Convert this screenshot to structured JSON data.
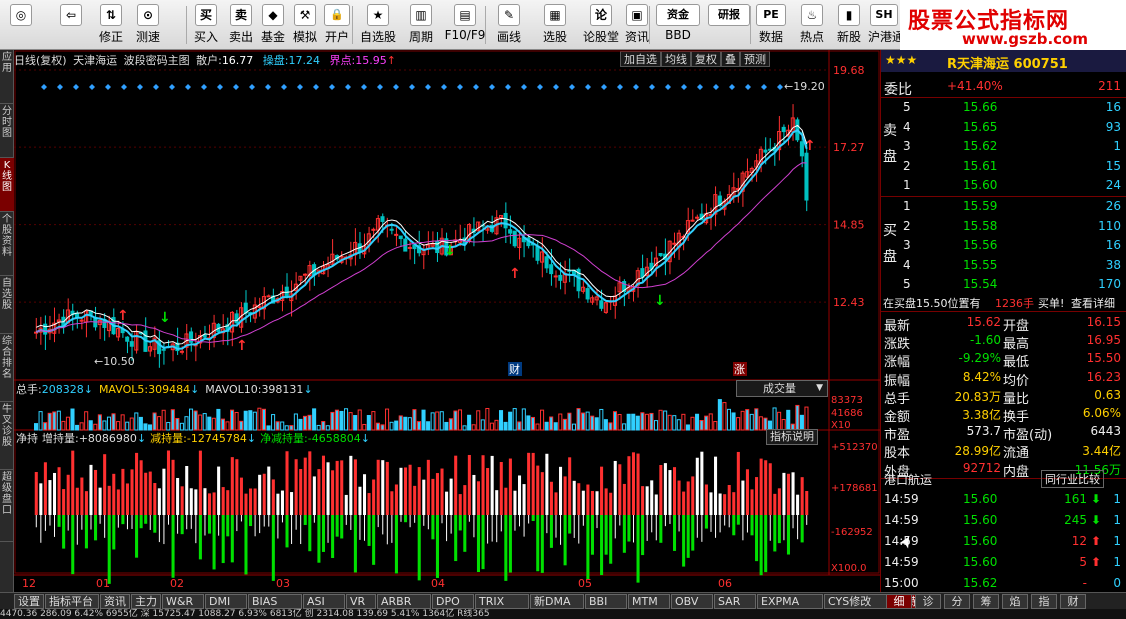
{
  "toolbar": [
    {
      "label": "",
      "icon": "app-logo-icon",
      "glyph": "◎"
    },
    {
      "label": "",
      "icon": "back-arrow-icon",
      "glyph": "⇦"
    },
    {
      "label": "修正",
      "icon": "refresh-icon",
      "glyph": "⇅"
    },
    {
      "label": "测速",
      "icon": "speed-test-icon",
      "glyph": "⊙"
    },
    {
      "label": "买入",
      "icon": "buy-icon",
      "glyph": "买"
    },
    {
      "label": "卖出",
      "icon": "sell-icon",
      "glyph": "卖"
    },
    {
      "label": "基金",
      "icon": "fund-icon",
      "glyph": "◆"
    },
    {
      "label": "模拟",
      "icon": "simulate-icon",
      "glyph": "⚒"
    },
    {
      "label": "开户",
      "icon": "open-account-icon",
      "glyph": "🔒"
    },
    {
      "label": "自选股",
      "icon": "watchlist-icon",
      "glyph": "★"
    },
    {
      "label": "周期",
      "icon": "period-icon",
      "glyph": "▥"
    },
    {
      "label": "F10/F9",
      "icon": "f10-icon",
      "glyph": "▤"
    },
    {
      "label": "画线",
      "icon": "draw-line-icon",
      "glyph": "✎"
    },
    {
      "label": "选股",
      "icon": "stock-picker-icon",
      "glyph": "▦"
    },
    {
      "label": "论股堂",
      "icon": "forum-icon",
      "glyph": "论"
    },
    {
      "label": "资讯",
      "icon": "news-icon",
      "glyph": "▣"
    },
    {
      "label": "BBD",
      "icon": "bbd-icon",
      "glyph": "资金"
    },
    {
      "label": "",
      "icon": "research-icon",
      "glyph": "研报"
    },
    {
      "label": "数据",
      "icon": "data-icon",
      "glyph": "PE"
    },
    {
      "label": "热点",
      "icon": "hot-icon",
      "glyph": "♨"
    },
    {
      "label": "新股",
      "icon": "new-stock-icon",
      "glyph": "▮"
    },
    {
      "label": "沪港通",
      "icon": "hk-connect-icon",
      "glyph": "SH"
    }
  ],
  "brand": {
    "line1": "股票公式指标网",
    "line2": "www.gszb.com"
  },
  "left_tabs": [
    "应用",
    "分时图",
    "K线图",
    "个股资料",
    "自选股",
    "综合排名",
    "牛叉诊股",
    "超级盘口"
  ],
  "info": {
    "period": "日线(复权)",
    "name": "天津海运",
    "indicator": "波段密码主图",
    "scatter_label": "散户:",
    "scatter_value": "16.77",
    "operator_label": "操盘:",
    "operator_value": "17.24",
    "point_label": "界点:",
    "point_value": "15.95"
  },
  "chart_buttons": [
    "加自选",
    "均线",
    "复权",
    "叠",
    "预测"
  ],
  "chart_data": {
    "type": "candlestick",
    "y_ticks": [
      "19.68",
      "17.27",
      "14.85",
      "12.43"
    ],
    "y_range": [
      10.0,
      19.68
    ],
    "high_annotation": "19.20",
    "low_annotation": "10.50",
    "x_labels": [
      "12",
      "01",
      "02",
      "03",
      "04",
      "05",
      "06"
    ],
    "markers": [
      "财",
      "涨"
    ]
  },
  "volume": {
    "total_label": "总手:",
    "total_value": "208328",
    "mavol5_label": "MAVOL5:",
    "mavol5_value": "309484",
    "mavol10_label": "MAVOL10:",
    "mavol10_value": "398131",
    "dropdown": "成交量",
    "y_ticks": [
      "83373",
      "41686",
      "X10"
    ]
  },
  "hold": {
    "title": "净持",
    "inc_label": "增持量:",
    "inc_value": "+8086980",
    "dec_label": "减持量:",
    "dec_value": "-12745784",
    "net_label": "净减持量:",
    "net_value": "-4658804",
    "help": "指标说明",
    "y_ticks": [
      "+512370",
      "+178681",
      "-162952",
      "X100.0"
    ]
  },
  "quote": {
    "title": "R天津海运 600751",
    "weibi_label": "委比",
    "weibi_value": "+41.40%",
    "weidiff": "211",
    "sell_label": "卖盘",
    "buy_label": "买盘",
    "asks": [
      {
        "lvl": "5",
        "price": "15.66",
        "vol": "16"
      },
      {
        "lvl": "4",
        "price": "15.65",
        "vol": "93"
      },
      {
        "lvl": "3",
        "price": "15.62",
        "vol": "1"
      },
      {
        "lvl": "2",
        "price": "15.61",
        "vol": "15"
      },
      {
        "lvl": "1",
        "price": "15.60",
        "vol": "24"
      }
    ],
    "bids": [
      {
        "lvl": "1",
        "price": "15.59",
        "vol": "26"
      },
      {
        "lvl": "2",
        "price": "15.58",
        "vol": "110"
      },
      {
        "lvl": "3",
        "price": "15.56",
        "vol": "16"
      },
      {
        "lvl": "4",
        "price": "15.55",
        "vol": "38"
      },
      {
        "lvl": "5",
        "price": "15.54",
        "vol": "170"
      }
    ],
    "msg_a": "在买盘15.50位置有",
    "msg_b": "1236手",
    "msg_c": "买单!",
    "msg_link": "查看详细",
    "stats": [
      {
        "l1": "最新",
        "v1": "15.62",
        "c1": "red",
        "l2": "开盘",
        "v2": "16.15",
        "c2": "red"
      },
      {
        "l1": "涨跌",
        "v1": "-1.60",
        "c1": "grn",
        "l2": "最高",
        "v2": "16.95",
        "c2": "red"
      },
      {
        "l1": "涨幅",
        "v1": "-9.29%",
        "c1": "grn",
        "l2": "最低",
        "v2": "15.50",
        "c2": "red"
      },
      {
        "l1": "振幅",
        "v1": "8.42%",
        "c1": "yel",
        "l2": "均价",
        "v2": "16.23",
        "c2": "red"
      },
      {
        "l1": "总手",
        "v1": "20.83万",
        "c1": "yel",
        "l2": "量比",
        "v2": "0.63",
        "c2": "yel"
      },
      {
        "l1": "金额",
        "v1": "3.38亿",
        "c1": "yel",
        "l2": "换手",
        "v2": "6.06%",
        "c2": "yel"
      },
      {
        "l1": "市盈",
        "v1": "573.7",
        "c1": "wht",
        "l2": "市盈(动)",
        "v2": "6443",
        "c2": "wht"
      },
      {
        "l1": "股本",
        "v1": "28.99亿",
        "c1": "yel",
        "l2": "流通",
        "v2": "3.44亿",
        "c2": "yel"
      },
      {
        "l1": "外盘",
        "v1": "92712",
        "c1": "red",
        "l2": "内盘",
        "v2": "11.56万",
        "c2": "grn"
      }
    ],
    "sector": "港口航运",
    "sector_btn": "同行业比较",
    "ticks": [
      {
        "time": "14:59",
        "price": "15.60",
        "vol": "161",
        "dir": "down",
        "n": "1"
      },
      {
        "time": "14:59",
        "price": "15.60",
        "vol": "245",
        "dir": "down",
        "n": "1"
      },
      {
        "time": "14:59",
        "price": "15.60",
        "vol": "12",
        "dir": "up",
        "n": "1"
      },
      {
        "time": "14:59",
        "price": "15.60",
        "vol": "5",
        "dir": "up",
        "n": "1"
      },
      {
        "time": "15:00",
        "price": "15.62",
        "vol": "-",
        "dir": "none",
        "n": "0"
      }
    ]
  },
  "bottom_tabs": [
    "设置",
    "指标平台",
    "资讯",
    "主力",
    "W&R",
    "DMI",
    "BIAS",
    "ASI",
    "VR",
    "ARBR",
    "DPO",
    "TRIX",
    "新DMA",
    "BBI",
    "MTM",
    "OBV",
    "SAR",
    "EXPMA",
    "CYS修改",
    "净持"
  ],
  "right_tabs": [
    "细",
    "诊",
    "分",
    "筹",
    "焰",
    "指",
    "财"
  ],
  "status": "4470.36 286.09 6.42% 6955亿 深 15725.47 1088.27 6.93% 6813亿 创 2314.08 139.69 5.41% 1364亿 R线365"
}
